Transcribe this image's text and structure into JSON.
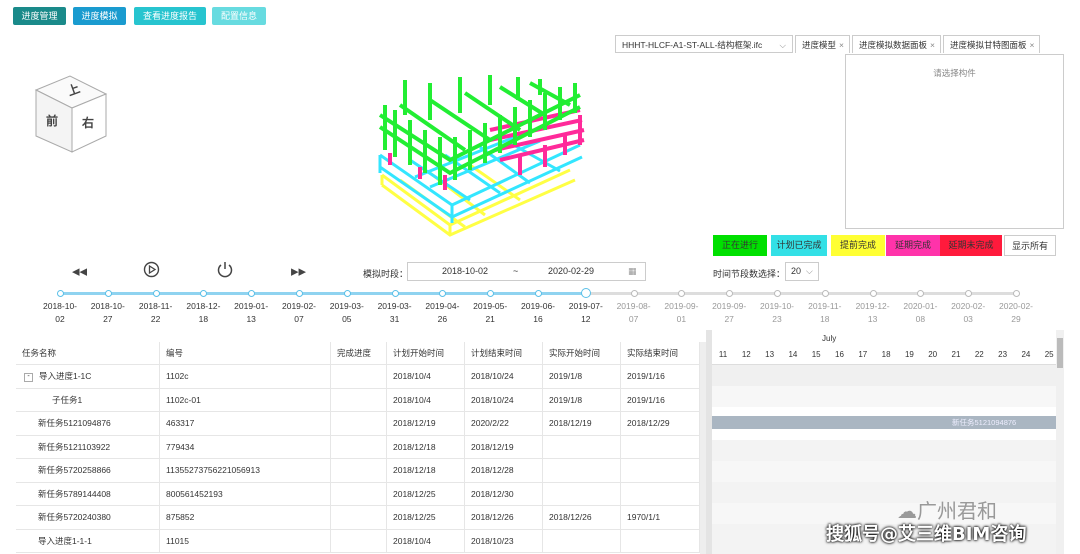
{
  "toolbar": {
    "buttons": [
      "进度管理",
      "进度模拟",
      "查看进度报告",
      "配置信息"
    ]
  },
  "file_select": {
    "value": "HHHT-HLCF-A1-ST-ALL-结构框架.ifc"
  },
  "tabs": [
    "进度模型",
    "进度模拟数据面板",
    "进度模拟甘特图面板"
  ],
  "panel": {
    "placeholder": "请选择构件"
  },
  "viewcube": {
    "top": "上",
    "front": "前",
    "right": "右"
  },
  "legend": [
    {
      "label": "正在进行",
      "color": "#00e000"
    },
    {
      "label": "计划已完成",
      "color": "#33e0e6"
    },
    {
      "label": "提前完成",
      "color": "#ffff33"
    },
    {
      "label": "延期完成",
      "color": "#ff33aa"
    },
    {
      "label": "延期未完成",
      "color": "#ff1a3c"
    },
    {
      "label": "显示所有",
      "color": "#ffffff"
    }
  ],
  "sim": {
    "label": "模拟时段：",
    "start": "2018-10-02",
    "sep": "~",
    "end": "2020-02-29",
    "segment_label": "时间节段数选择：",
    "segment_value": "20"
  },
  "timeline": {
    "ticks": [
      [
        "2018-10-",
        "02"
      ],
      [
        "2018-10-",
        "27"
      ],
      [
        "2018-11-",
        "22"
      ],
      [
        "2018-12-",
        "18"
      ],
      [
        "2019-01-",
        "13"
      ],
      [
        "2019-02-",
        "07"
      ],
      [
        "2019-03-",
        "05"
      ],
      [
        "2019-03-",
        "31"
      ],
      [
        "2019-04-",
        "26"
      ],
      [
        "2019-05-",
        "21"
      ],
      [
        "2019-06-",
        "16"
      ],
      [
        "2019-07-",
        "12"
      ],
      [
        "2019-08-",
        "07"
      ],
      [
        "2019-09-",
        "01"
      ],
      [
        "2019-09-",
        "27"
      ],
      [
        "2019-10-",
        "23"
      ],
      [
        "2019-11-",
        "18"
      ],
      [
        "2019-12-",
        "13"
      ],
      [
        "2020-01-",
        "08"
      ],
      [
        "2020-02-",
        "03"
      ],
      [
        "2020-02-",
        "29"
      ]
    ],
    "current_index": 11
  },
  "table": {
    "headers": [
      "任务名称",
      "编号",
      "完成进度",
      "计划开始时间",
      "计划结束时间",
      "实际开始时间",
      "实际结束时间"
    ],
    "rows": [
      [
        "导入进度1-1C",
        "1102c",
        "",
        "2018/10/4",
        "2018/10/24",
        "2019/1/8",
        "2019/1/16"
      ],
      [
        "子任务1",
        "1102c-01",
        "",
        "2018/10/4",
        "2018/10/24",
        "2019/1/8",
        "2019/1/16"
      ],
      [
        "新任务5121094876",
        "463317",
        "",
        "2018/12/19",
        "2020/2/22",
        "2018/12/19",
        "2018/12/29"
      ],
      [
        "新任务5121103922",
        "779434",
        "",
        "2018/12/18",
        "2018/12/19",
        "",
        ""
      ],
      [
        "新任务5720258866",
        "11355273756221056913",
        "",
        "2018/12/18",
        "2018/12/28",
        "",
        ""
      ],
      [
        "新任务5789144408",
        "800561452193",
        "",
        "2018/12/25",
        "2018/12/30",
        "",
        ""
      ],
      [
        "新任务5720240380",
        "875852",
        "",
        "2018/12/25",
        "2018/12/26",
        "2018/12/26",
        "1970/1/1"
      ],
      [
        "导入进度1-1-1",
        "11015",
        "",
        "2018/10/4",
        "2018/10/23",
        "",
        ""
      ]
    ]
  },
  "gantt": {
    "month": "July",
    "days": [
      "11",
      "12",
      "13",
      "14",
      "15",
      "16",
      "17",
      "18",
      "19",
      "20",
      "21",
      "22",
      "23",
      "24",
      "25"
    ],
    "bar_label": "新任务5121094876"
  },
  "watermark": {
    "line1": "广州君和",
    "line2": "搜狐号@艾三维BIM咨询"
  }
}
